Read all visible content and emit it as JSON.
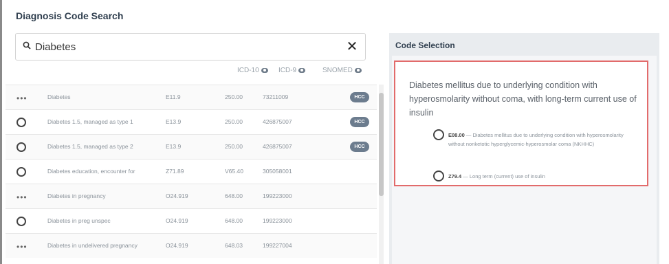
{
  "page": {
    "title": "Diagnosis Code Search"
  },
  "search": {
    "value": "Diabetes",
    "clear_label": "✕"
  },
  "columns": {
    "icd10": "ICD-10",
    "icd9": "ICD-9",
    "snomed": "SNOMED"
  },
  "rows": [
    {
      "control": "more",
      "control_label": "•••",
      "desc": "Diabetes",
      "icd10": "E11.9",
      "icd9": "250.00",
      "snomed": "73211009",
      "hcc": "HCC"
    },
    {
      "control": "radio",
      "control_label": "",
      "desc": "Diabetes 1.5, managed as type 1",
      "icd10": "E13.9",
      "icd9": "250.00",
      "snomed": "426875007",
      "hcc": "HCC"
    },
    {
      "control": "radio",
      "control_label": "",
      "desc": "Diabetes 1.5, managed as type 2",
      "icd10": "E13.9",
      "icd9": "250.00",
      "snomed": "426875007",
      "hcc": "HCC"
    },
    {
      "control": "radio",
      "control_label": "",
      "desc": "Diabetes education, encounter for",
      "icd10": "Z71.89",
      "icd9": "V65.40",
      "snomed": "305058001",
      "hcc": ""
    },
    {
      "control": "more",
      "control_label": "•••",
      "desc": "Diabetes in pregnancy",
      "icd10": "O24.919",
      "icd9": "648.00",
      "snomed": "199223000",
      "hcc": ""
    },
    {
      "control": "radio",
      "control_label": "",
      "desc": "Diabetes in preg unspec",
      "icd10": "O24.919",
      "icd9": "648.00",
      "snomed": "199223000",
      "hcc": ""
    },
    {
      "control": "more",
      "control_label": "•••",
      "desc": "Diabetes in undelivered pregnancy",
      "icd10": "O24.919",
      "icd9": "648.03",
      "snomed": "199227004",
      "hcc": ""
    }
  ],
  "selection": {
    "title": "Code Selection",
    "description": "Diabetes mellitus due to underlying condition with hyperosmolarity without coma, with long-term current use of insulin",
    "options": [
      {
        "code": "E08.00",
        "text": " — Diabetes mellitus due to underlying condition with hyperosmolarity without nonketotic hyperglycemic-hyperosmolar coma (NKHHC)"
      },
      {
        "code": "Z79.4",
        "text": " — Long term (current) use of insulin"
      }
    ]
  }
}
